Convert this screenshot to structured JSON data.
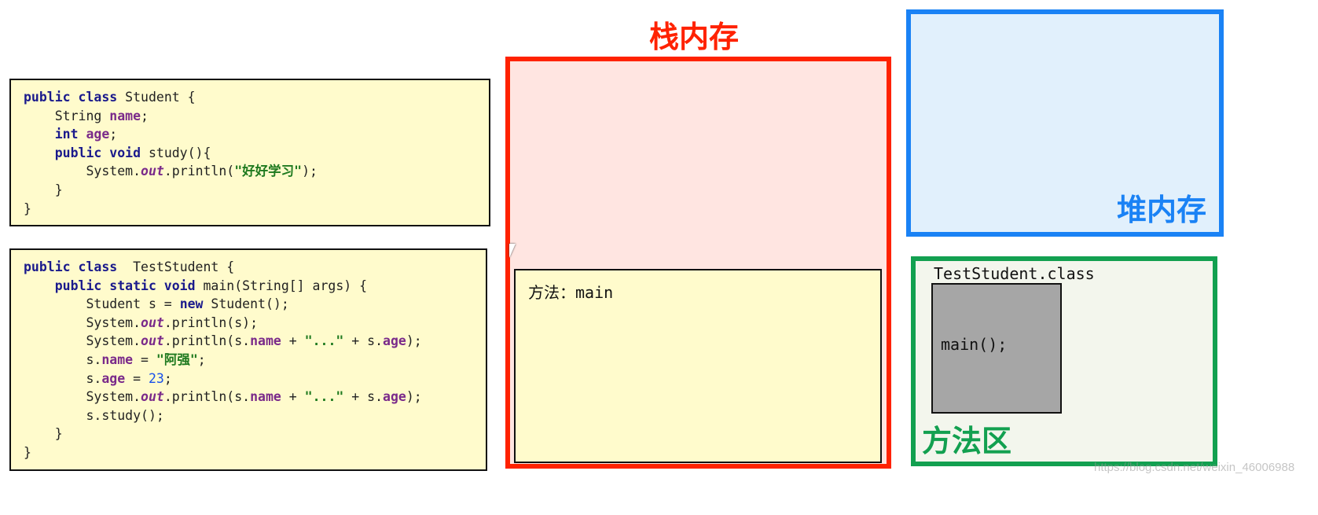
{
  "code_student": [
    [
      [
        "kw",
        "public class"
      ],
      [
        "",
        "Student {"
      ]
    ],
    [
      [
        "",
        "    String "
      ],
      [
        "fd",
        "name"
      ],
      [
        "",
        ";"
      ]
    ],
    [
      [
        "kw",
        "    int"
      ],
      [
        "",
        " "
      ],
      [
        "fd",
        "age"
      ],
      [
        "",
        ";"
      ]
    ],
    [
      [
        "kw",
        "    public void"
      ],
      [
        "",
        " study(){"
      ]
    ],
    [
      [
        "",
        "        System."
      ],
      [
        "it",
        "out"
      ],
      [
        "",
        ".println("
      ],
      [
        "st",
        "\"好好学习\""
      ],
      [
        "",
        ");"
      ]
    ],
    [
      [
        "",
        "    }"
      ]
    ],
    [
      [
        "",
        "}"
      ]
    ]
  ],
  "code_test": [
    [
      [
        "kw",
        "public class"
      ],
      [
        "",
        " TestStudent {"
      ]
    ],
    [
      [
        "kw",
        "    public static void"
      ],
      [
        "",
        " main(String[] args) {"
      ]
    ],
    [
      [
        "",
        "        Student s = "
      ],
      [
        "kw",
        "new"
      ],
      [
        "",
        " Student();"
      ]
    ],
    [
      [
        "",
        "        System."
      ],
      [
        "it",
        "out"
      ],
      [
        "",
        ".println(s);"
      ]
    ],
    [
      [
        "",
        "        System."
      ],
      [
        "it",
        "out"
      ],
      [
        "",
        ".println(s."
      ],
      [
        "fd",
        "name"
      ],
      [
        "",
        " + "
      ],
      [
        "st",
        "\"...\""
      ],
      [
        "",
        " + s."
      ],
      [
        "fd",
        "age"
      ],
      [
        "",
        ");"
      ]
    ],
    [
      [
        "",
        "        s."
      ],
      [
        "fd",
        "name"
      ],
      [
        "",
        " = "
      ],
      [
        "st",
        "\"阿强\""
      ],
      [
        "",
        ";"
      ]
    ],
    [
      [
        "",
        "        s."
      ],
      [
        "fd",
        "age"
      ],
      [
        "",
        " = "
      ],
      [
        "nm",
        "23"
      ],
      [
        "",
        ";"
      ]
    ],
    [
      [
        "",
        "        System."
      ],
      [
        "it",
        "out"
      ],
      [
        "",
        ".println(s."
      ],
      [
        "fd",
        "name"
      ],
      [
        "",
        " + "
      ],
      [
        "st",
        "\"...\""
      ],
      [
        "",
        " + s."
      ],
      [
        "fd",
        "age"
      ],
      [
        "",
        ");"
      ]
    ],
    [
      [
        "",
        "        s.study();"
      ]
    ],
    [
      [
        "",
        "    }"
      ]
    ],
    [
      [
        "",
        "}"
      ]
    ]
  ],
  "stack": {
    "title": "栈内存",
    "frame_label": "方法：main",
    "color": "#ff2200"
  },
  "heap": {
    "title": "堆内存",
    "color": "#1a82f5"
  },
  "method_area": {
    "title": "方法区",
    "class_name": "TestStudent.class",
    "method": "main();",
    "color": "#12a050"
  },
  "watermark": "https://blog.csdn.net/weixin_46006988"
}
